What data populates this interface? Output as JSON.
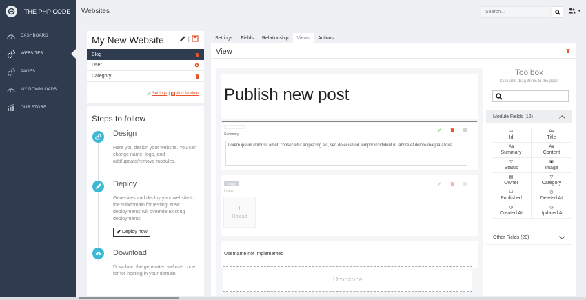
{
  "sidebar": {
    "app_title": "THE PHP CODE",
    "items": [
      {
        "label": "DASHBOARD",
        "icon": "dashboard-icon"
      },
      {
        "label": "WEBSITES",
        "icon": "cogs-icon"
      },
      {
        "label": "PAGES",
        "icon": "cogs-icon"
      },
      {
        "label": "MY DOWNLOADS",
        "icon": "download-gauge-icon"
      },
      {
        "label": "OUR STORE",
        "icon": "store-chart-icon"
      }
    ]
  },
  "topbar": {
    "title": "Websites",
    "search_placeholder": "Search..."
  },
  "website_card": {
    "title": "My New Website",
    "modules": [
      "Blog",
      "User",
      "Category"
    ],
    "settings_link": "Settings",
    "add_module_link": "Add Module"
  },
  "steps": {
    "title": "Steps to follow",
    "items": [
      {
        "title": "Design",
        "desc": "Here you design your website. You can change name, logo, and add/update/remove modules."
      },
      {
        "title": "Deploy",
        "desc": "Generates and deploy your website to the subdomain for testing. New deployments will override existing deployments.",
        "button": "Deploy now"
      },
      {
        "title": "Download",
        "desc": "Download the generated website code for for hosting in your domain"
      }
    ]
  },
  "tabs": [
    "Settings",
    "Fields",
    "Relationship",
    "Views",
    "Actions"
  ],
  "editor": {
    "title": "View",
    "publish_title": "Publish new post",
    "summary_label": "Summary",
    "summary_text": "Lorem ipsum dolor sit amet, consectetur adipiscing elit, sed do eiusmod tempor incididunt ut labore et dolore magna aliqua",
    "image_tag": "Image",
    "image_label": "Image",
    "upload_label": "Upload",
    "username_text": "Username not implemented",
    "dropzone": "Dropzone"
  },
  "toolbox": {
    "title": "Toolbox",
    "subtitle": "Click and drag items to the page",
    "module_fields": "Module Fields (12)",
    "other_fields": "Other Fields (20)",
    "fields": [
      {
        "label": "Id",
        "glyph": "⊸"
      },
      {
        "label": "Title",
        "glyph": "Aa"
      },
      {
        "label": "Summary",
        "glyph": "Aa"
      },
      {
        "label": "Content",
        "glyph": "Aa"
      },
      {
        "label": "Status",
        "glyph": "▽"
      },
      {
        "label": "Image",
        "glyph": "▣"
      },
      {
        "label": "Owner",
        "glyph": "▤"
      },
      {
        "label": "Category",
        "glyph": "▽"
      },
      {
        "label": "Published",
        "glyph": "☐"
      },
      {
        "label": "Deleted At",
        "glyph": "◷"
      },
      {
        "label": "Created At",
        "glyph": "◷"
      },
      {
        "label": "Updated At",
        "glyph": "◷"
      }
    ]
  },
  "colors": {
    "sidebar": "#2f3b4f",
    "accent": "#e6542e",
    "step_icon": "#3db9d6",
    "edit_green": "#7dc47e"
  }
}
